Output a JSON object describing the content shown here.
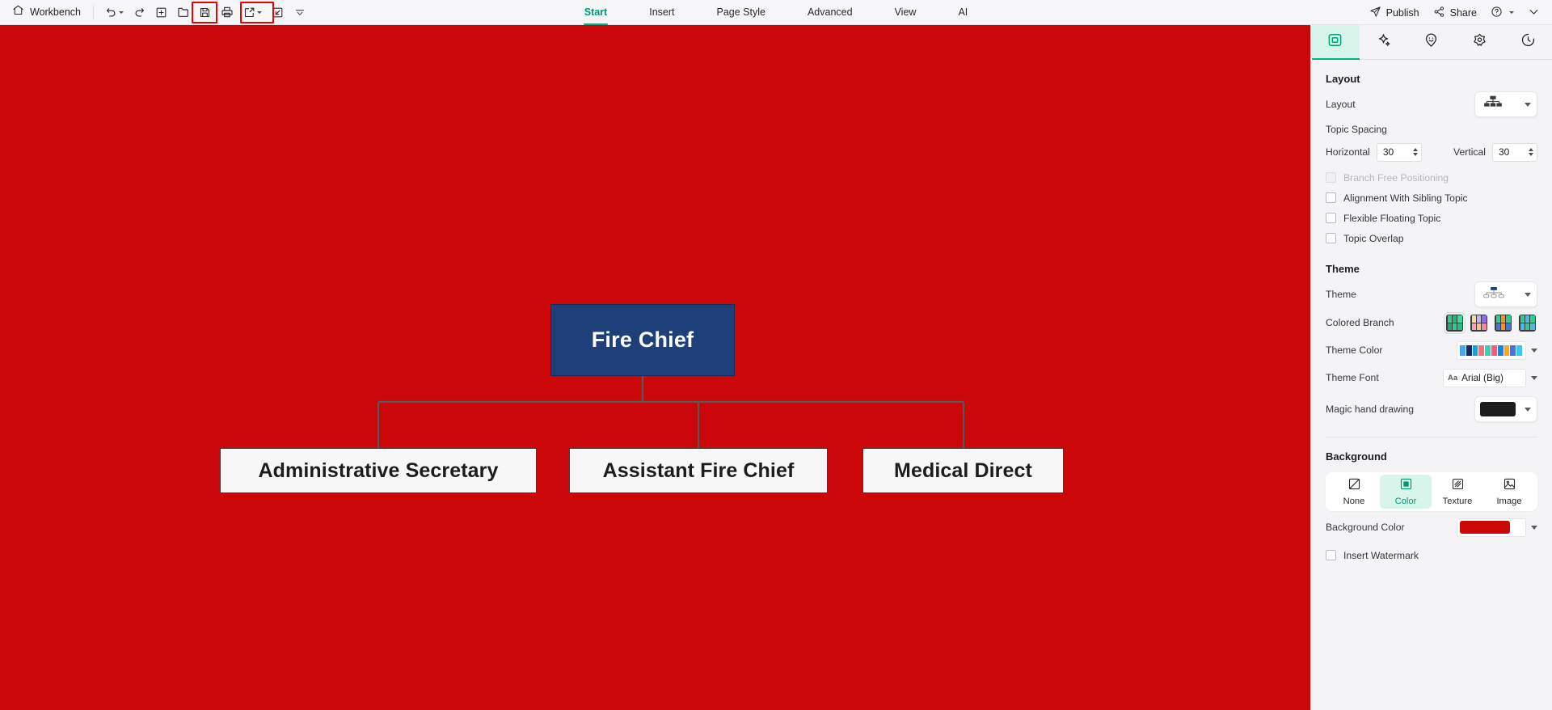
{
  "topbar": {
    "home_label": "Workbench",
    "left_icons": [
      {
        "name": "undo-icon",
        "glyph": "undo",
        "has_caret": true
      },
      {
        "name": "redo-icon",
        "glyph": "redo",
        "has_caret": false
      },
      {
        "name": "new-icon",
        "glyph": "new",
        "has_caret": false
      },
      {
        "name": "open-folder-icon",
        "glyph": "folder",
        "has_caret": false
      },
      {
        "name": "save-icon",
        "glyph": "save",
        "has_caret": false
      },
      {
        "name": "print-icon",
        "glyph": "print",
        "has_caret": false
      },
      {
        "name": "export-icon",
        "glyph": "export",
        "has_caret": true
      },
      {
        "name": "import-icon",
        "glyph": "import",
        "has_caret": false
      },
      {
        "name": "more-toolbar-icon",
        "glyph": "chevron",
        "has_caret": false
      }
    ],
    "tabs": [
      {
        "label": "Start",
        "active": true
      },
      {
        "label": "Insert",
        "active": false
      },
      {
        "label": "Page Style",
        "active": false
      },
      {
        "label": "Advanced",
        "active": false
      },
      {
        "label": "View",
        "active": false
      },
      {
        "label": "AI",
        "active": false
      }
    ],
    "right": {
      "publish_label": "Publish",
      "share_label": "Share",
      "help_label": "",
      "more_label": ""
    },
    "highlight_color": "#ee0000"
  },
  "canvas": {
    "background_color": "#cc070a",
    "connector_color": "#555a5e",
    "nodes": {
      "root": {
        "text": "Fire Chief",
        "fill": "#1f3f7a",
        "text_color": "#ffffff"
      },
      "children": [
        {
          "text": "Administrative Secretary",
          "fill": "#f7f7f7",
          "text_color": "#1c1c1c"
        },
        {
          "text": "Assistant Fire Chief",
          "fill": "#f7f7f7",
          "text_color": "#1c1c1c"
        },
        {
          "text": "Medical Direct",
          "fill": "#f7f7f7",
          "text_color": "#1c1c1c"
        }
      ]
    }
  },
  "panel": {
    "tabs": [
      {
        "name": "style-tab",
        "icon": "square-frame-icon",
        "active": true
      },
      {
        "name": "ai-tab",
        "icon": "sparkle-icon",
        "active": false
      },
      {
        "name": "sticker-tab",
        "icon": "smiley-pin-icon",
        "active": false
      },
      {
        "name": "shape-tab",
        "icon": "flower-gear-icon",
        "active": false
      },
      {
        "name": "history-tab",
        "icon": "clock-dashed-icon",
        "active": false
      }
    ],
    "layout_section": {
      "title": "Layout",
      "layout_label": "Layout",
      "topic_spacing_label": "Topic Spacing",
      "horizontal_label": "Horizontal",
      "horizontal_value": "30",
      "vertical_label": "Vertical",
      "vertical_value": "30",
      "checkboxes": [
        {
          "label": "Branch Free Positioning",
          "checked": false,
          "disabled": true
        },
        {
          "label": "Alignment With Sibling Topic",
          "checked": false,
          "disabled": false
        },
        {
          "label": "Flexible Floating Topic",
          "checked": false,
          "disabled": false
        },
        {
          "label": "Topic Overlap",
          "checked": false,
          "disabled": false
        }
      ]
    },
    "theme_section": {
      "title": "Theme",
      "theme_label": "Theme",
      "colored_branch_label": "Colored Branch",
      "theme_color_label": "Theme Color",
      "theme_font_label": "Theme Font",
      "theme_font_value": "Arial (Big)",
      "theme_font_prefix": "Aa",
      "magic_hand_label": "Magic hand drawing",
      "magic_hand_color": "#1d1d1d",
      "theme_color_swatches": [
        "#4aa3f0",
        "#132a63",
        "#18a0e0",
        "#f2717e",
        "#3ecfb2",
        "#f05a8c",
        "#1a82e2",
        "#f5a623",
        "#4a72d8",
        "#39c6ef"
      ],
      "colored_branch_options": [
        {
          "selected": true,
          "colors": [
            "#2ecc8f",
            "#26b37d",
            "#3ddba0",
            "#25a874",
            "#31c994",
            "#29bd84"
          ]
        },
        {
          "selected": false,
          "colors": [
            "#f7d9a0",
            "#c3b2f0",
            "#8e6fe8",
            "#f5a3b5",
            "#f3c28a",
            "#f08ca0"
          ]
        },
        {
          "selected": false,
          "colors": [
            "#2ecc8f",
            "#f0932b",
            "#2ecc8f",
            "#4a72d8",
            "#f0932b",
            "#4a72d8"
          ]
        },
        {
          "selected": false,
          "colors": [
            "#2ecc8f",
            "#49b9e8",
            "#2ecc8f",
            "#49b9e8",
            "#2ecc8f",
            "#49b9e8"
          ]
        }
      ]
    },
    "background_section": {
      "title": "Background",
      "options": [
        {
          "label": "None",
          "icon": "none-slash-icon",
          "active": false
        },
        {
          "label": "Color",
          "icon": "solid-square-icon",
          "active": true
        },
        {
          "label": "Texture",
          "icon": "hatched-square-icon",
          "active": false
        },
        {
          "label": "Image",
          "icon": "picture-icon",
          "active": false
        }
      ],
      "background_color_label": "Background Color",
      "background_color_value": "#cc070a",
      "insert_watermark_label": "Insert Watermark",
      "insert_watermark_checked": false
    }
  }
}
